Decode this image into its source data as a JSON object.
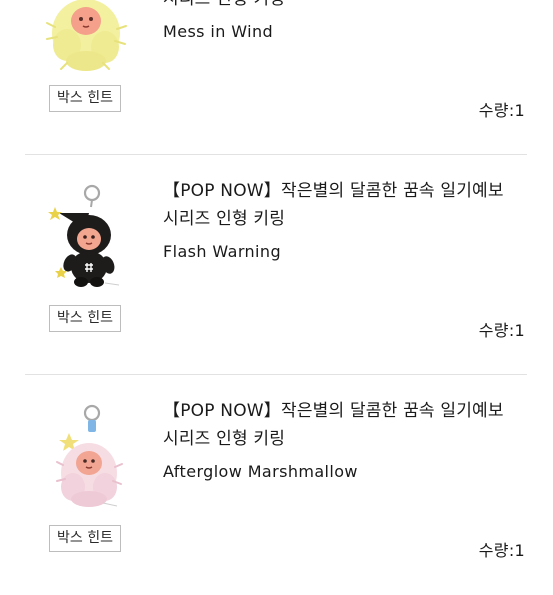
{
  "items": [
    {
      "title": "【POP NOW】작은별의 달콤한 꿈속 일기예보\n시리즈 인형 키링",
      "variant": "Mess in Wind",
      "hint_label": "박스 힌트",
      "quantity": "수량:1",
      "thumb_icon": "yellow-fluffy-keychain-doll",
      "thumb_color": "#f3f0a0"
    },
    {
      "title": "【POP NOW】작은별의 달콤한 꿈속 일기예보\n시리즈 인형 키링",
      "variant": "Flash Warning",
      "hint_label": "박스 힌트",
      "quantity": "수량:1",
      "thumb_icon": "black-star-hat-keychain-doll",
      "thumb_color": "#1e1b1b"
    },
    {
      "title": "【POP NOW】작은별의 달콤한 꿈속 일기예보\n시리즈 인형 키링",
      "variant": "Afterglow Marshmallow",
      "hint_label": "박스 힌트",
      "quantity": "수량:1",
      "thumb_icon": "pink-fluffy-keychain-doll",
      "thumb_color": "#f6dde4"
    }
  ],
  "colors": {
    "text": "#1a1a1a",
    "divider": "#e2e2e2",
    "button_border": "#bdbdbd"
  }
}
